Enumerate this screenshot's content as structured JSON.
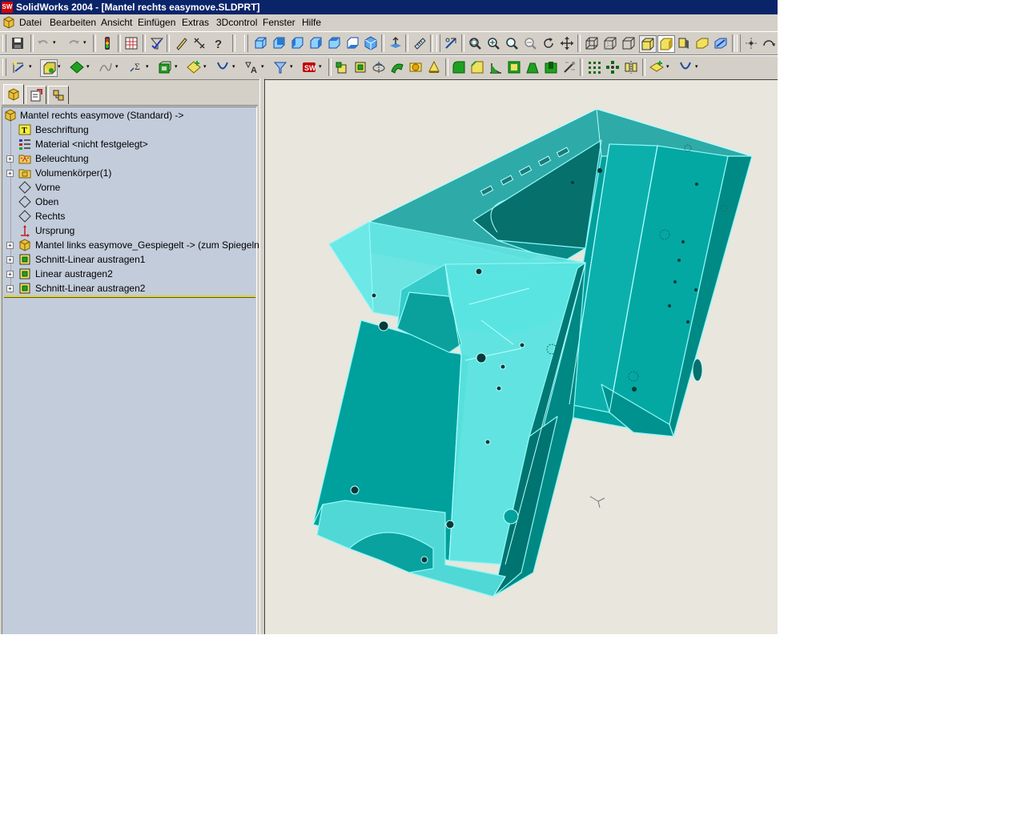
{
  "window": {
    "title": "SolidWorks 2004 - [Mantel rechts easymove.SLDPRT]",
    "logo_text": "SW"
  },
  "menu": [
    "Datei",
    "Bearbeiten",
    "Ansicht",
    "Einfügen",
    "Extras",
    "3Dcontrol",
    "Fenster",
    "Hilfe"
  ],
  "tree": {
    "root": "Mantel rechts easymove  (Standard) ->",
    "items": [
      {
        "label": "Beschriftung",
        "icon": "annotation-icon",
        "expandable": false
      },
      {
        "label": "Material <nicht festgelegt>",
        "icon": "material-icon",
        "expandable": false
      },
      {
        "label": "Beleuchtung",
        "icon": "lighting-folder-icon",
        "expandable": true
      },
      {
        "label": "Volumenkörper(1)",
        "icon": "solid-bodies-folder-icon",
        "expandable": true
      },
      {
        "label": "Vorne",
        "icon": "plane-icon",
        "expandable": false
      },
      {
        "label": "Oben",
        "icon": "plane-icon",
        "expandable": false
      },
      {
        "label": "Rechts",
        "icon": "plane-icon",
        "expandable": false
      },
      {
        "label": "Ursprung",
        "icon": "origin-icon",
        "expandable": false
      },
      {
        "label": "Mantel links easymove_Gespiegelt -> (zum Spiegeln)",
        "icon": "derived-part-icon",
        "expandable": true
      },
      {
        "label": "Schnitt-Linear austragen1",
        "icon": "cut-extrude-icon",
        "expandable": true
      },
      {
        "label": "Linear austragen2",
        "icon": "boss-extrude-icon",
        "expandable": true
      },
      {
        "label": "Schnitt-Linear austragen2",
        "icon": "cut-extrude-icon",
        "expandable": true
      }
    ]
  },
  "colors": {
    "model_dark": "#00a09c",
    "model_light": "#5ee6e6",
    "model_edge": "#8ff8f8",
    "tree_bg": "#c3ccdb",
    "viewport_bg": "#e8e6dd"
  }
}
